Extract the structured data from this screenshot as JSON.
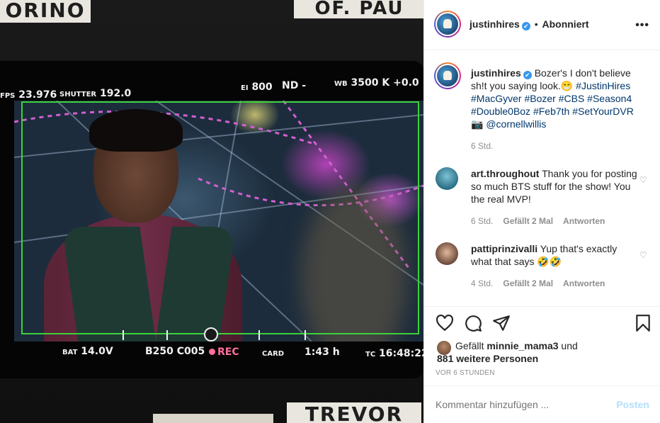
{
  "photo": {
    "signs": {
      "top_left": "ORINO",
      "top_right": "OF. PAU",
      "bottom": "TREVOR"
    },
    "hud": {
      "fps_label": "FPS",
      "fps_value": "23.976",
      "shutter_label": "SHUTTER",
      "shutter_value": "192.0",
      "ei_label": "EI",
      "ei_value": "800",
      "nd_label": "ND",
      "nd_value": "-",
      "wb_label": "WB",
      "wb_value": "3500 K",
      "wb_extra": "+0.0",
      "bat_label": "BAT",
      "bat_value": "14.0V",
      "clip": "B250 C005",
      "rec": "REC",
      "card_label": "CARD",
      "card_value": "1:43 h",
      "tc_label": "TC",
      "tc_value": "16:48:22"
    }
  },
  "header": {
    "username": "justinhires",
    "verified_icon": "✔",
    "separator": "•",
    "follow_status": "Abonniert",
    "more_icon": "•••"
  },
  "caption": {
    "username": "justinhires",
    "text": "Bozer's I don't believe sh!t you saying look.😁",
    "tags": "#JustinHires #MacGyver #Bozer #CBS #Season4 #Double0Boz #Feb7th #SetYourDVR",
    "camera": "📷",
    "mention": "@cornellwillis",
    "time": "6 Std."
  },
  "comments": [
    {
      "username": "art.throughout",
      "text": "Thank you for posting so much BTS stuff for the show! You the real MVP!",
      "time": "6 Std.",
      "likes": "Gefällt 2 Mal",
      "reply": "Antworten",
      "heart_icon": "♡"
    },
    {
      "username": "pattiprinzivalli",
      "text": "Yup that's exactly what that says 🤣🤣",
      "time": "4 Std.",
      "likes": "Gefällt 2 Mal",
      "reply": "Antworten",
      "heart_icon": "♡"
    }
  ],
  "actions": {
    "icons": [
      "heart-icon",
      "comment-icon",
      "share-icon",
      "bookmark-icon"
    ],
    "likes_prefix": "Gefällt",
    "liked_by": "minnie_mama3",
    "likes_and": "und",
    "others": "881 weitere Personen",
    "time_ago": "VOR 6 STUNDEN"
  },
  "comment_bar": {
    "placeholder": "Kommentar hinzufügen ...",
    "post_label": "Posten"
  },
  "colors": {
    "verified": "#3897f0",
    "link": "#00376b",
    "muted": "#8e8e8e",
    "post_disabled": "#b2dffc",
    "frame_guide": "#3bd23b"
  }
}
